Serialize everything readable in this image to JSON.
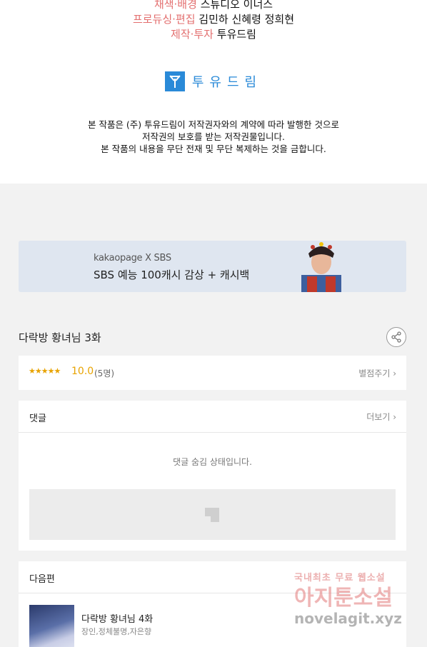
{
  "credits": {
    "lines": [
      {
        "role": "채색·배경",
        "name": "스튜디오 이너스"
      },
      {
        "role": "프로듀싱·편집",
        "name": "김민하 신혜령 정희현"
      },
      {
        "role": "제작·투자",
        "name": "투유드림"
      }
    ],
    "logo_text": "투유드림",
    "notice_lines": [
      "본 작품은 (주) 투유드림이 저작권자와의 계약에 따라 발행한 것으로",
      "저작권의 보호를 받는 저작권물입니다.",
      "본 작품의 내용을 무단 전재 및 무단 복제하는 것을 금합니다."
    ]
  },
  "banner": {
    "brand": "kakaopage X SBS",
    "headline": "SBS 예능 100캐시 감상 + 캐시백",
    "background": "#dfe6f0"
  },
  "episode": {
    "title": "다락방 황녀님 3화",
    "share_icon": "share-icon"
  },
  "rating": {
    "stars": "★★★★★",
    "score": "10.0",
    "count": "(5명)",
    "rate_link": "별점주기",
    "color": "#e8a300"
  },
  "comments": {
    "title": "댓글",
    "more": "더보기",
    "hidden_message": "댓글 숨김 상태입니다."
  },
  "next": {
    "title": "다음편",
    "item_title": "다락방 황녀님 4화",
    "item_authors": "장인,정체불명,자은향"
  },
  "watermark": {
    "line1": "국내최초 무료 웹소설",
    "line2": "아지툰소설",
    "line3": "novelagit.xyz"
  }
}
